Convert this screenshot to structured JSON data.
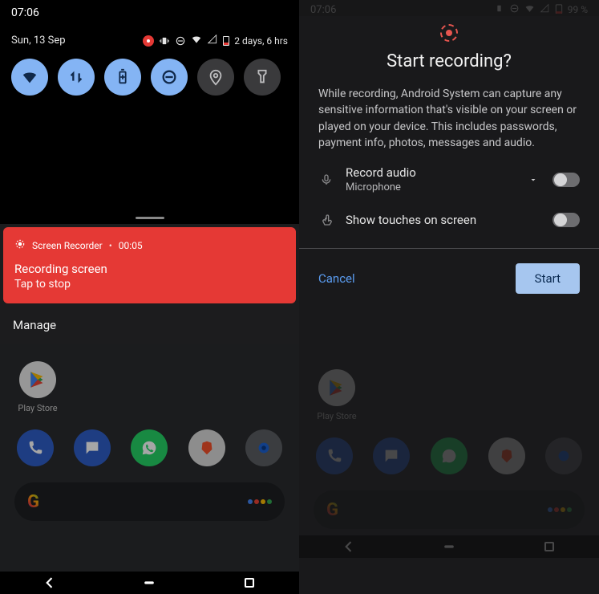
{
  "left": {
    "clock": "07:06",
    "date": "Sun, 13 Sep",
    "battery_hint": "2 days, 6 hrs",
    "tiles": [
      {
        "name": "wifi",
        "on": true
      },
      {
        "name": "data",
        "on": true
      },
      {
        "name": "battery-saver",
        "on": true
      },
      {
        "name": "dnd",
        "on": true
      },
      {
        "name": "location",
        "on": false
      },
      {
        "name": "flashlight",
        "on": false
      }
    ],
    "recording": {
      "app": "Screen Recorder",
      "timer": "00:05",
      "title": "Recording screen",
      "subtitle": "Tap to stop"
    },
    "manage_label": "Manage",
    "home": {
      "play_store": "Play Store",
      "dock": [
        "Phone",
        "Messages",
        "WhatsApp",
        "Brave",
        "Camera"
      ]
    }
  },
  "right": {
    "clock": "07:06",
    "batt_pct": "99 %",
    "dialog": {
      "title": "Start recording?",
      "body": "While recording, Android System can capture any sensitive information that's visible on your screen or played on your device. This includes passwords, payment info, photos, messages and audio.",
      "row1_label": "Record audio",
      "row1_sub": "Microphone",
      "row2_label": "Show touches on screen",
      "cancel": "Cancel",
      "start": "Start"
    },
    "home": {
      "play_store": "Play Store",
      "dock": [
        "Phone",
        "Messages",
        "WhatsApp",
        "Brave",
        "Camera"
      ]
    }
  },
  "colors": {
    "accent": "#84b4f4",
    "danger": "#e53935",
    "start_btn": "#a6c6ef"
  }
}
